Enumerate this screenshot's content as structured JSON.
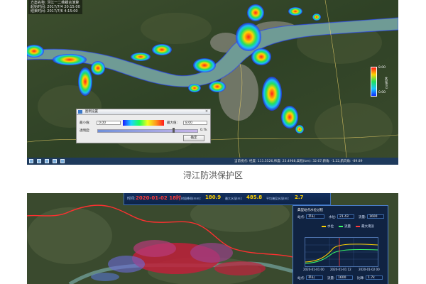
{
  "screenshot1": {
    "info": {
      "line1": "方案名称: 浔江一二维耦合演算",
      "line2": "起始时间: 2017/7/4 20:15:00",
      "line3": "结束时间: 2017/7/6 4:15:00"
    },
    "legend": {
      "max": "8.00",
      "min": "0.00",
      "title": "水深(m)",
      "caption": "淹没"
    },
    "dialog": {
      "title": "图例设置",
      "min_label": "最小值:",
      "min_value": "0.00",
      "max_label": "最大值:",
      "max_value": "8.00",
      "opacity_label": "透明度:",
      "opacity_value": "0.7k",
      "ok_label": "确定",
      "close_symbol": "×"
    },
    "status": {
      "text": "当前视点: 经度: 111.5526,纬度: 23.4968,高程(km): 32.67,俯角: -1.22,航向角: -89.89"
    }
  },
  "caption": "浔江防洪保护区",
  "screenshot2": {
    "topbar": {
      "time_label": "时间:",
      "datetime": "2020-01-02 18时",
      "rain_label": "时段降雨(mm):",
      "rain_value": "180.9",
      "max_depth_label": "最大水深(m):",
      "max_depth_value": "485.8",
      "avg_depth_label": "平均淹没水深(m):",
      "avg_depth_value": "2.7"
    },
    "panel": {
      "title": "典型站点水位过程",
      "field1_label": "站点:",
      "field1_value": "平山",
      "field2_label": "水位:",
      "field2_value": "21.43",
      "field3_label": "流量:",
      "field3_value": "1600",
      "legend_a": "水位",
      "legend_b": "流量",
      "legend_c": "最大淹没",
      "x_start": "2020-01-01 00",
      "x_mid": "2020-01-01 12",
      "x_end": "2020-01-02 00",
      "bottom1_label": "站点:",
      "bottom1_value": "平山",
      "bottom2_label": "流量:",
      "bottom2_value": "1600",
      "bottom3_label": "比降:",
      "bottom3_value": "1.7k"
    }
  }
}
